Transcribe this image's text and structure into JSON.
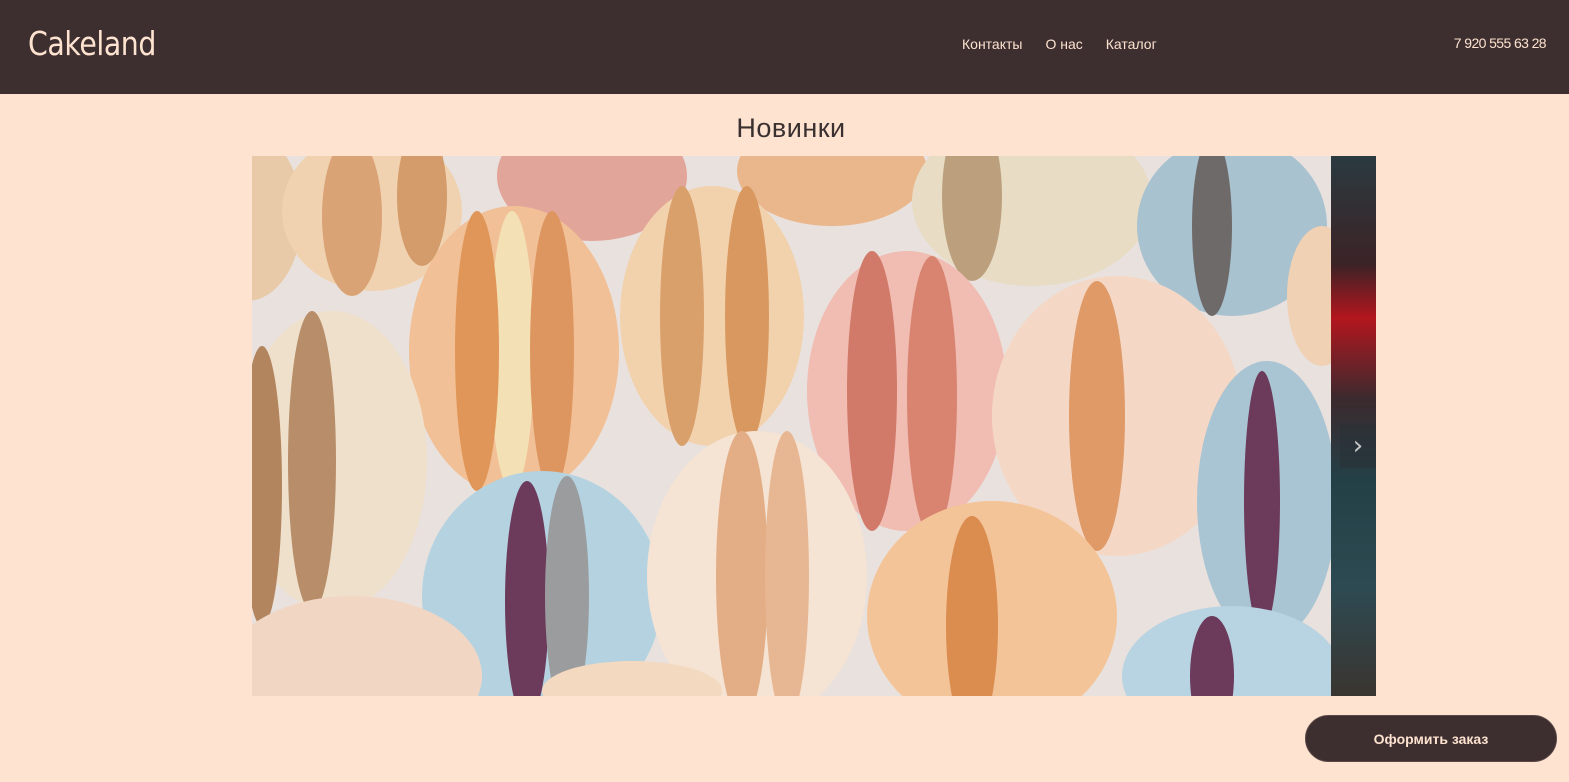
{
  "header": {
    "logo": "Cakeland",
    "nav": [
      {
        "label": "Контакты"
      },
      {
        "label": "О нас"
      },
      {
        "label": "Каталог"
      }
    ],
    "phone": "7 920 555 63 28"
  },
  "main": {
    "section_title": "Новинки",
    "slider": {
      "image": "macarons-photo",
      "next_icon": "chevron-right-icon"
    }
  },
  "order_button": {
    "label": "Оформить заказ"
  }
}
